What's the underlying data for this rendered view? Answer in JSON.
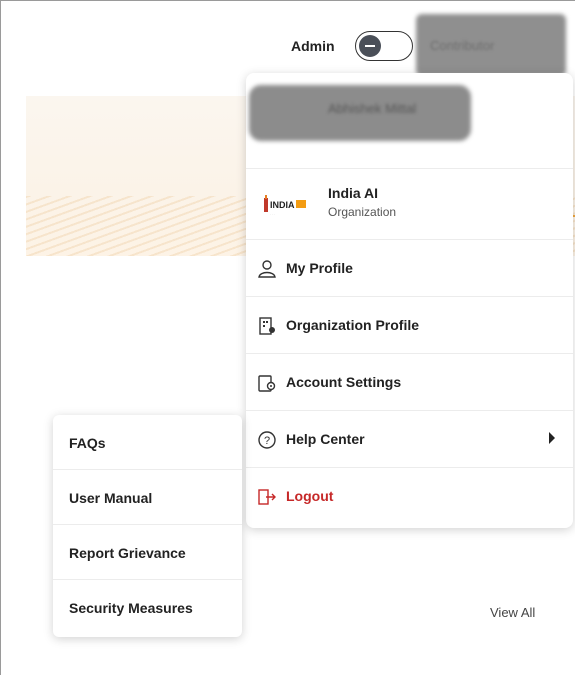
{
  "header": {
    "role_label": "Admin",
    "role_toggle_state": "admin",
    "contributor_label": "Contributor"
  },
  "account_menu": {
    "user_name_blurred": "Abhishek Mittal",
    "organization": {
      "name": "India AI",
      "type": "Organization"
    },
    "items": [
      {
        "label": "My Profile",
        "icon": "user-icon"
      },
      {
        "label": "Organization Profile",
        "icon": "organization-icon"
      },
      {
        "label": "Account Settings",
        "icon": "settings-icon"
      },
      {
        "label": "Help Center",
        "icon": "help-icon",
        "has_submenu": true
      },
      {
        "label": "Logout",
        "icon": "logout-icon"
      }
    ]
  },
  "help_submenu": {
    "items": [
      {
        "label": "FAQs"
      },
      {
        "label": "User Manual"
      },
      {
        "label": "Report Grievance"
      },
      {
        "label": "Security Measures"
      }
    ]
  },
  "page": {
    "view_all_label": "View All"
  },
  "colors": {
    "logout": "#c62828",
    "banner": "#fbf3e8",
    "accent": "#f0a840"
  }
}
